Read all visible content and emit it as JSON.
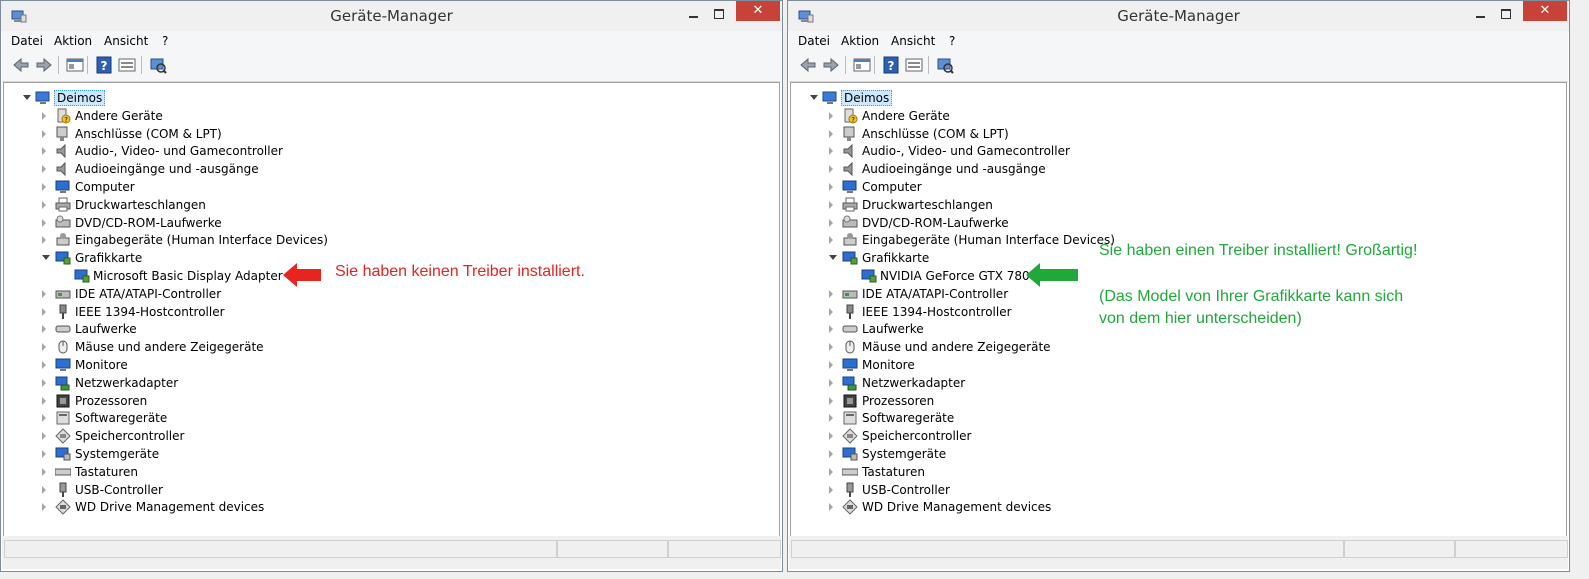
{
  "colors": {
    "annotation_red": "#e8241f",
    "annotation_green": "#21a83a",
    "close_button": "#c7433a"
  },
  "windows": [
    {
      "title": "Geräte-Manager",
      "menu": [
        "Datei",
        "Aktion",
        "Ansicht",
        "?"
      ],
      "close_label": "✕",
      "root": "Deimos",
      "categories": [
        {
          "label": "Andere Geräte",
          "icon": "other-devices-icon"
        },
        {
          "label": "Anschlüsse (COM & LPT)",
          "icon": "ports-icon"
        },
        {
          "label": "Audio-, Video- und Gamecontroller",
          "icon": "speaker-icon"
        },
        {
          "label": "Audioeingänge und -ausgänge",
          "icon": "speaker-icon"
        },
        {
          "label": "Computer",
          "icon": "computer-icon"
        },
        {
          "label": "Druckwarteschlangen",
          "icon": "printer-icon"
        },
        {
          "label": "DVD/CD-ROM-Laufwerke",
          "icon": "dvd-drive-icon"
        },
        {
          "label": "Eingabegeräte (Human Interface Devices)",
          "icon": "hid-icon"
        },
        {
          "label": "Grafikkarte",
          "icon": "display-adapter-icon",
          "expanded": true,
          "child": "Microsoft Basic Display Adapter"
        },
        {
          "label": "IDE ATA/ATAPI-Controller",
          "icon": "ide-controller-icon"
        },
        {
          "label": "IEEE 1394-Hostcontroller",
          "icon": "firewire-icon"
        },
        {
          "label": "Laufwerke",
          "icon": "disk-drive-icon"
        },
        {
          "label": "Mäuse und andere Zeigegeräte",
          "icon": "mouse-icon"
        },
        {
          "label": "Monitore",
          "icon": "monitor-icon"
        },
        {
          "label": "Netzwerkadapter",
          "icon": "network-adapter-icon"
        },
        {
          "label": "Prozessoren",
          "icon": "processor-icon"
        },
        {
          "label": "Softwaregeräte",
          "icon": "software-device-icon"
        },
        {
          "label": "Speichercontroller",
          "icon": "storage-controller-icon"
        },
        {
          "label": "Systemgeräte",
          "icon": "system-device-icon"
        },
        {
          "label": "Tastaturen",
          "icon": "keyboard-icon"
        },
        {
          "label": "USB-Controller",
          "icon": "usb-icon"
        },
        {
          "label": "WD Drive Management devices",
          "icon": "wd-device-icon"
        }
      ],
      "annotation": {
        "lines": [
          "Sie haben keinen Treiber installiert."
        ],
        "color": "#e8241f"
      }
    },
    {
      "title": "Geräte-Manager",
      "menu": [
        "Datei",
        "Aktion",
        "Ansicht",
        "?"
      ],
      "close_label": "✕",
      "root": "Deimos",
      "categories": [
        {
          "label": "Andere Geräte",
          "icon": "other-devices-icon"
        },
        {
          "label": "Anschlüsse (COM & LPT)",
          "icon": "ports-icon"
        },
        {
          "label": "Audio-, Video- und Gamecontroller",
          "icon": "speaker-icon"
        },
        {
          "label": "Audioeingänge und -ausgänge",
          "icon": "speaker-icon"
        },
        {
          "label": "Computer",
          "icon": "computer-icon"
        },
        {
          "label": "Druckwarteschlangen",
          "icon": "printer-icon"
        },
        {
          "label": "DVD/CD-ROM-Laufwerke",
          "icon": "dvd-drive-icon"
        },
        {
          "label": "Eingabegeräte (Human Interface Devices)",
          "icon": "hid-icon"
        },
        {
          "label": "Grafikkarte",
          "icon": "display-adapter-icon",
          "expanded": true,
          "child": "NVIDIA GeForce GTX 780"
        },
        {
          "label": "IDE ATA/ATAPI-Controller",
          "icon": "ide-controller-icon"
        },
        {
          "label": "IEEE 1394-Hostcontroller",
          "icon": "firewire-icon"
        },
        {
          "label": "Laufwerke",
          "icon": "disk-drive-icon"
        },
        {
          "label": "Mäuse und andere Zeigegeräte",
          "icon": "mouse-icon"
        },
        {
          "label": "Monitore",
          "icon": "monitor-icon"
        },
        {
          "label": "Netzwerkadapter",
          "icon": "network-adapter-icon"
        },
        {
          "label": "Prozessoren",
          "icon": "processor-icon"
        },
        {
          "label": "Softwaregeräte",
          "icon": "software-device-icon"
        },
        {
          "label": "Speichercontroller",
          "icon": "storage-controller-icon"
        },
        {
          "label": "Systemgeräte",
          "icon": "system-device-icon"
        },
        {
          "label": "Tastaturen",
          "icon": "keyboard-icon"
        },
        {
          "label": "USB-Controller",
          "icon": "usb-icon"
        },
        {
          "label": "WD Drive Management devices",
          "icon": "wd-device-icon"
        }
      ],
      "annotation": {
        "lines": [
          "Sie haben einen Treiber installiert! Großartig!",
          "(Das Model von Ihrer Grafikkarte kann sich",
          "von dem hier unterscheiden)"
        ],
        "color": "#21a83a"
      }
    }
  ]
}
